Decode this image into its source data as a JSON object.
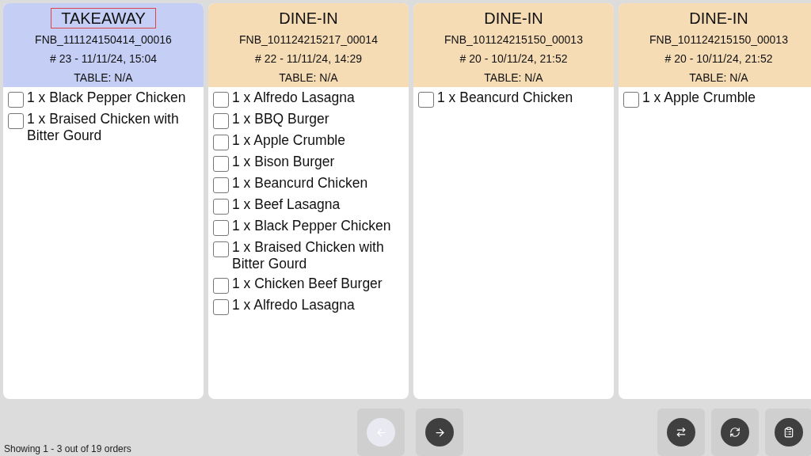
{
  "orders": [
    {
      "kind": "takeaway",
      "title": "TAKEAWAY",
      "title_outlined": true,
      "order_no": "FNB_111124150414_00016",
      "number_time": "# 23 - 11/11/24, 15:04",
      "table": "TABLE: N/A",
      "items": [
        {
          "text": "1 x Black Pepper Chicken",
          "checked": false
        },
        {
          "text": "1 x Braised Chicken with Bitter Gourd",
          "checked": false
        }
      ]
    },
    {
      "kind": "dine_in",
      "title": "DINE-IN",
      "title_outlined": false,
      "order_no": "FNB_101124215217_00014",
      "number_time": "# 22 - 11/11/24, 14:29",
      "table": "TABLE: N/A",
      "items": [
        {
          "text": "1 x Alfredo Lasagna",
          "checked": false
        },
        {
          "text": "1 x BBQ Burger",
          "checked": false
        },
        {
          "text": "1 x Apple Crumble",
          "checked": false
        },
        {
          "text": "1 x Bison Burger",
          "checked": false
        },
        {
          "text": "1 x Beancurd Chicken",
          "checked": false
        },
        {
          "text": "1 x Beef Lasagna",
          "checked": false
        },
        {
          "text": "1 x Black Pepper Chicken",
          "checked": false
        },
        {
          "text": "1 x Braised Chicken with Bitter Gourd",
          "checked": false
        },
        {
          "text": "1 x Chicken Beef Burger",
          "checked": false
        },
        {
          "text": "1 x Alfredo Lasagna",
          "checked": false
        }
      ]
    },
    {
      "kind": "dine_in",
      "title": "DINE-IN",
      "title_outlined": false,
      "order_no": "FNB_101124215150_00013",
      "number_time": "# 20 - 10/11/24, 21:52",
      "table": "TABLE: N/A",
      "items": [
        {
          "text": "1 x Beancurd Chicken",
          "checked": false
        }
      ]
    },
    {
      "kind": "dine_in",
      "title": "DINE-IN",
      "title_outlined": false,
      "order_no": "FNB_101124215150_00013",
      "number_time": "# 20 - 10/11/24, 21:52",
      "table": "TABLE: N/A",
      "items": [
        {
          "text": "1 x Apple Crumble",
          "checked": false
        }
      ]
    }
  ],
  "footer": {
    "status": "Showing 1 - 3 out of 19 orders",
    "nav_buttons": [
      {
        "kind": "prev",
        "disabled": true
      },
      {
        "kind": "next",
        "disabled": false
      }
    ],
    "tool_buttons": [
      {
        "kind": "swap"
      },
      {
        "kind": "refresh"
      },
      {
        "kind": "report"
      }
    ]
  }
}
